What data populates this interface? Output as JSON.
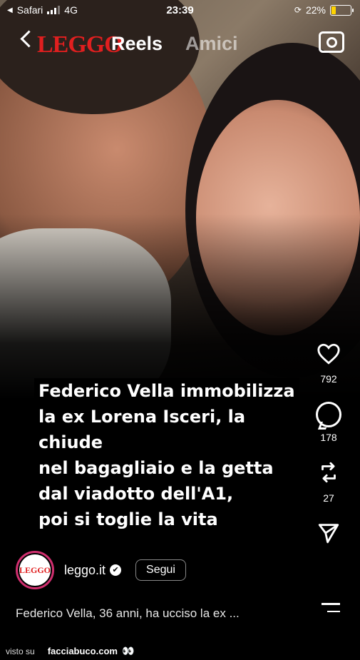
{
  "status_bar": {
    "carrier": "Safari",
    "network": "4G",
    "time": "23:39",
    "battery": "22%"
  },
  "nav": {
    "logo": "LEGGO",
    "tab_reels": "Reels",
    "tab_amici": "Amici",
    "camera_icon": "camera-icon"
  },
  "reel": {
    "headline_lines": [
      "Federico Vella immobilizza",
      "la ex Lorena Isceri, la chiude",
      "nel bagagliaio e la getta",
      "dal viadotto dell'A1,",
      "poi si toglie la vita"
    ],
    "likes": "792",
    "comments": "178",
    "reposts": "27"
  },
  "profile": {
    "avatar_text": "LEGGO",
    "username": "leggo.it",
    "follow_label": "Segui"
  },
  "caption": "Federico Vella, 36 anni, ha ucciso la ex ...",
  "footer": {
    "visto": "visto su",
    "site": "facciabuco.com",
    "eyes": "👀"
  },
  "colors": {
    "accent": "#e01f1f",
    "avatar_ring": "#d02f6f",
    "battery_low": "#ffd400"
  }
}
